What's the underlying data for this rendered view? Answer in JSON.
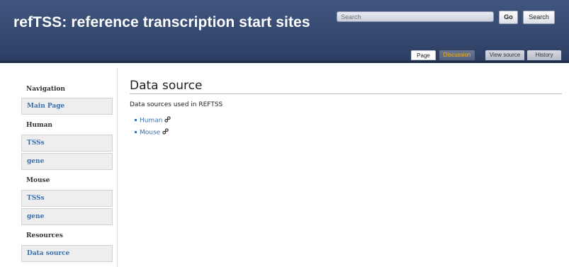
{
  "header": {
    "site_title": "refTSS: reference transcription start sites",
    "search_placeholder": "Search",
    "go_label": "Go",
    "search_label": "Search"
  },
  "tabs": [
    {
      "label": "Page"
    },
    {
      "label": "Discussion"
    },
    {
      "label": "View source"
    },
    {
      "label": "History"
    }
  ],
  "sidebar": {
    "navigation_heading": "Navigation",
    "main_page": "Main Page",
    "human_heading": "Human",
    "human_tss": "TSSs",
    "human_gene": "gene",
    "mouse_heading": "Mouse",
    "mouse_tss": "TSSs",
    "mouse_gene": "gene",
    "resources_heading": "Resources",
    "data_source": "Data source"
  },
  "main": {
    "title": "Data source",
    "intro": "Data sources used in REFTSS",
    "links": [
      {
        "label": "Human",
        "icon": "external-link-icon"
      },
      {
        "label": "Mouse",
        "icon": "external-link-icon"
      }
    ]
  },
  "colors": {
    "header_bg": "#34486f",
    "link": "#3a6fb0",
    "discussion_tab_text": "#f0b630"
  }
}
